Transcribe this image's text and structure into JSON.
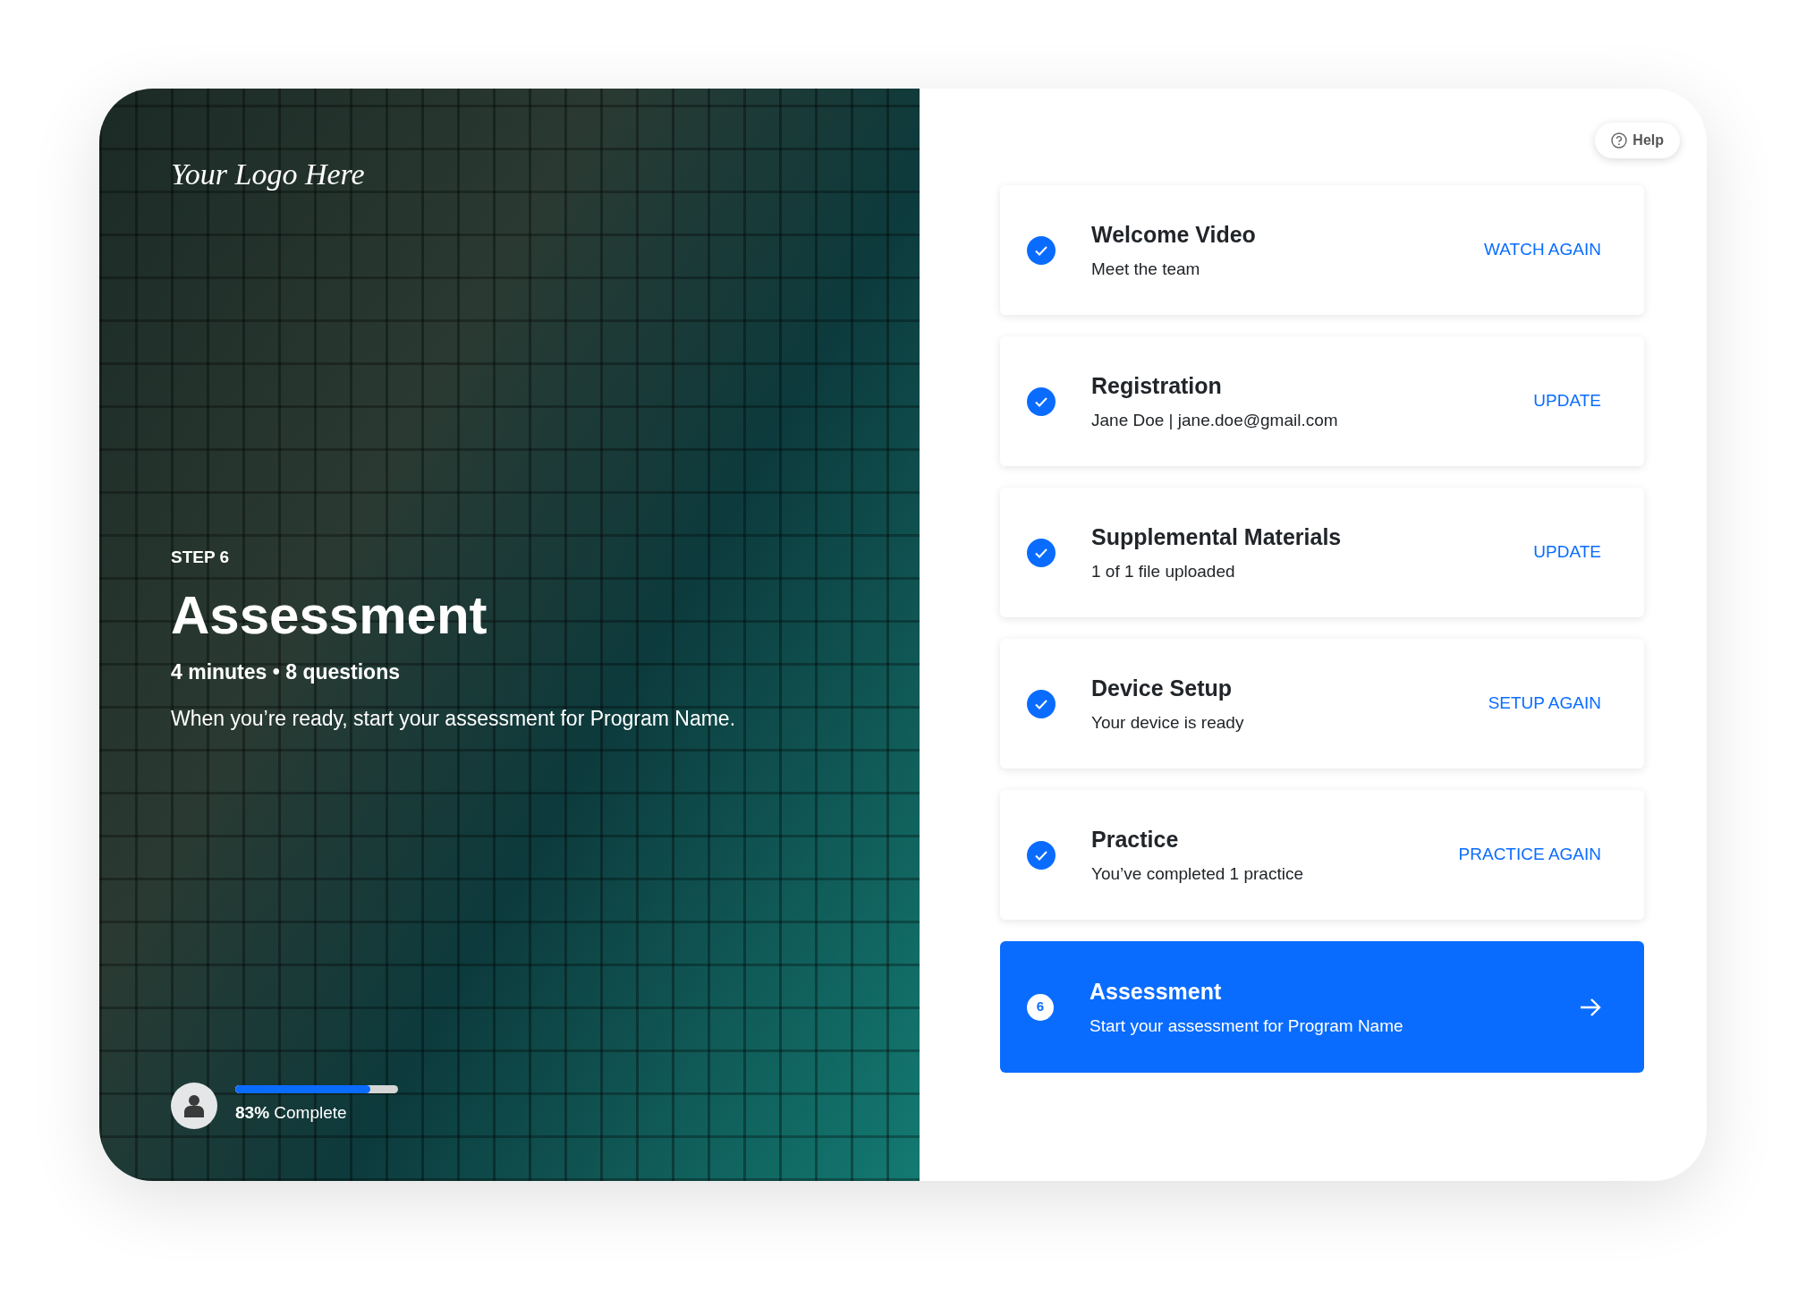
{
  "hero": {
    "logo": "Your Logo Here",
    "step_label": "STEP 6",
    "title": "Assessment",
    "meta": "4 minutes • 8 questions",
    "description": "When you’re ready, start your assessment for Program Name.",
    "progress": {
      "level": 0.83,
      "label": "**83%** Complete"
    }
  },
  "help_button": {
    "label": "Help"
  },
  "steps": [
    {
      "kind": "done",
      "title": "Welcome Video",
      "subtitle": "Meet the team",
      "action": "WATCH AGAIN"
    },
    {
      "kind": "done",
      "title": "Registration",
      "subtitle": "Jane Doe | jane.doe@gmail.com",
      "action": "UPDATE"
    },
    {
      "kind": "done",
      "title": "Supplemental Materials",
      "subtitle": "1 of 1 file uploaded",
      "action": "UPDATE"
    },
    {
      "kind": "done",
      "title": "Device Setup",
      "subtitle": "Your device is ready",
      "action": "SETUP AGAIN"
    },
    {
      "kind": "done",
      "title": "Practice",
      "subtitle": "You’ve completed 1 practice",
      "action": "PRACTICE AGAIN"
    },
    {
      "kind": "current",
      "number": "6",
      "title": "Assessment",
      "subtitle": "Start your assessment for Program Name"
    }
  ]
}
